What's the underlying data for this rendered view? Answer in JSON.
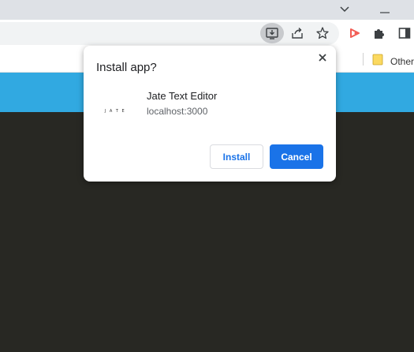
{
  "titlebar": {
    "tab_search_icon": "chevron-down-icon",
    "minimize_icon": "minimize-icon"
  },
  "toolbar": {
    "icons": [
      "install-app-icon",
      "share-icon",
      "bookmark-star-icon",
      "extension-red-icon",
      "puzzle-icon",
      "side-panel-icon"
    ]
  },
  "bookmarks": {
    "folder_label": "Other"
  },
  "dialog": {
    "title": "Install app?",
    "close_icon": "close-icon",
    "app_icon_text": "J A T E",
    "app_name": "Jate Text Editor",
    "app_origin": "localhost:3000",
    "install_label": "Install",
    "cancel_label": "Cancel"
  },
  "colors": {
    "app_header": "#31a9e1",
    "app_body": "#282823",
    "primary_button": "#1a73e8",
    "extension_icon": "#f25c54"
  }
}
